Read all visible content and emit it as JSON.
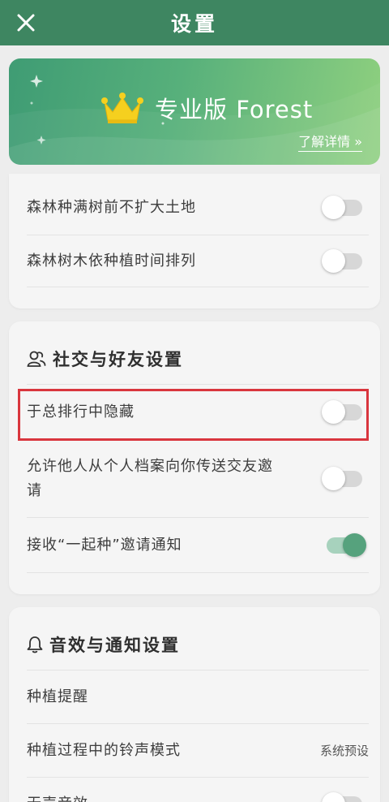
{
  "topbar": {
    "title": "设置",
    "close_icon": "close-icon"
  },
  "banner": {
    "crown_icon": "crown-icon",
    "title": "专业版 Forest",
    "link": "了解详情 »"
  },
  "forest_settings": {
    "items": [
      {
        "label": "森林种满树前不扩大土地",
        "toggle": false
      },
      {
        "label": "森林树木依种植时间排列",
        "toggle": false
      }
    ]
  },
  "social": {
    "title": "社交与好友设置",
    "icon": "friends-icon",
    "items": [
      {
        "label": "于总排行中隐藏",
        "toggle": false
      },
      {
        "label_line1": "允许他人从个人档案向你传送交友邀",
        "label_line2": "请",
        "toggle": false
      },
      {
        "label": "接收“一起种”邀请通知",
        "toggle": true
      }
    ]
  },
  "sound": {
    "title": "音效与通知设置",
    "icon": "bell-icon",
    "items": [
      {
        "label": "种植提醒"
      },
      {
        "label": "种植过程中的铃声模式",
        "value": "系统预设"
      },
      {
        "label": "无声音效",
        "toggle": false
      }
    ]
  },
  "colors": {
    "primary": "#3e8661",
    "toggle_on": "#56a27d",
    "highlight": "#d9363e"
  }
}
